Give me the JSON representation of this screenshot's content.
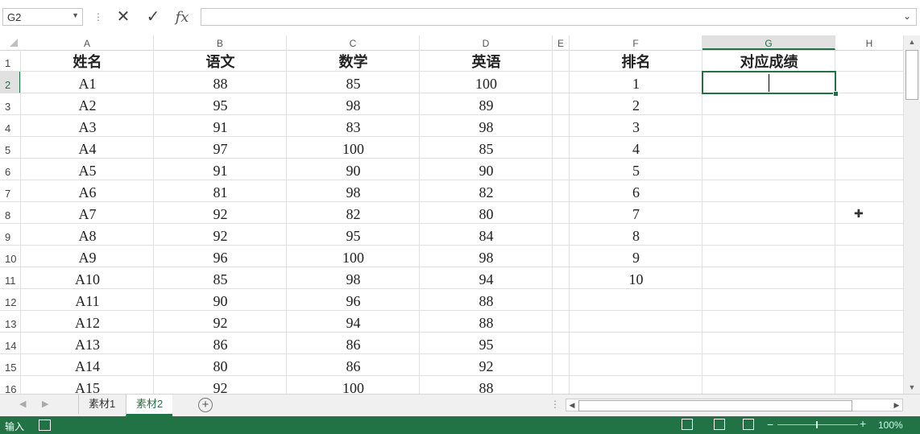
{
  "name_box": {
    "value": "G2"
  },
  "formula": {
    "value": ""
  },
  "icons": {
    "cancel": "x-icon",
    "enter": "check-icon",
    "function": "fx-icon"
  },
  "fx_label": "fx",
  "columns": [
    "A",
    "B",
    "C",
    "D",
    "E",
    "F",
    "G",
    "H"
  ],
  "selected_column": "G",
  "rows": [
    "1",
    "2",
    "3",
    "4",
    "5",
    "6",
    "7",
    "8",
    "9",
    "10",
    "11",
    "12",
    "13",
    "14",
    "15",
    "16"
  ],
  "selected_row": "2",
  "headers": {
    "name": "姓名",
    "chinese": "语文",
    "math": "数学",
    "english": "英语",
    "rank": "排名",
    "score": "对应成绩"
  },
  "records": [
    {
      "name": "A1",
      "chinese": "88",
      "math": "85",
      "english": "100",
      "rank": "1",
      "score": ""
    },
    {
      "name": "A2",
      "chinese": "95",
      "math": "98",
      "english": "89",
      "rank": "2",
      "score": ""
    },
    {
      "name": "A3",
      "chinese": "91",
      "math": "83",
      "english": "98",
      "rank": "3",
      "score": ""
    },
    {
      "name": "A4",
      "chinese": "97",
      "math": "100",
      "english": "85",
      "rank": "4",
      "score": ""
    },
    {
      "name": "A5",
      "chinese": "91",
      "math": "90",
      "english": "90",
      "rank": "5",
      "score": ""
    },
    {
      "name": "A6",
      "chinese": "81",
      "math": "98",
      "english": "82",
      "rank": "6",
      "score": ""
    },
    {
      "name": "A7",
      "chinese": "92",
      "math": "82",
      "english": "80",
      "rank": "7",
      "score": ""
    },
    {
      "name": "A8",
      "chinese": "92",
      "math": "95",
      "english": "84",
      "rank": "8",
      "score": ""
    },
    {
      "name": "A9",
      "chinese": "96",
      "math": "100",
      "english": "98",
      "rank": "9",
      "score": ""
    },
    {
      "name": "A10",
      "chinese": "85",
      "math": "98",
      "english": "94",
      "rank": "10",
      "score": ""
    },
    {
      "name": "A11",
      "chinese": "90",
      "math": "96",
      "english": "88",
      "rank": "",
      "score": ""
    },
    {
      "name": "A12",
      "chinese": "92",
      "math": "94",
      "english": "88",
      "rank": "",
      "score": ""
    },
    {
      "name": "A13",
      "chinese": "86",
      "math": "86",
      "english": "95",
      "rank": "",
      "score": ""
    },
    {
      "name": "A14",
      "chinese": "80",
      "math": "86",
      "english": "92",
      "rank": "",
      "score": ""
    },
    {
      "name": "A15",
      "chinese": "92",
      "math": "100",
      "english": "88",
      "rank": "",
      "score": ""
    }
  ],
  "sheets": [
    {
      "label": "素材1",
      "active": false
    },
    {
      "label": "素材2",
      "active": true
    }
  ],
  "status": {
    "mode": "输入",
    "zoom": "100%"
  },
  "colors": {
    "accent": "#217346"
  }
}
